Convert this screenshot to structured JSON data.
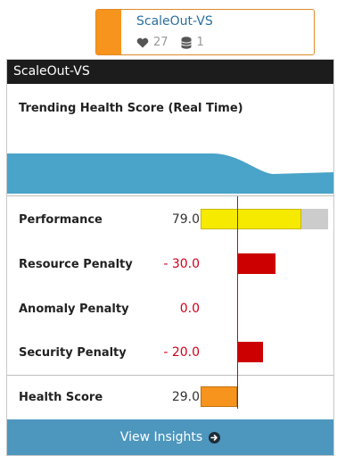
{
  "node": {
    "title": "ScaleOut-VS",
    "health_count": "27",
    "db_count": "1",
    "accent_color": "#f7941d"
  },
  "panel": {
    "header": "ScaleOut-VS",
    "trend_title": "Trending Health Score (Real Time)",
    "trend_color": "#4aa3c9"
  },
  "metrics": [
    {
      "label": "Performance",
      "value": "79.0",
      "bar_value": 79.0,
      "bar_max": 100,
      "color": "#f5ea00"
    },
    {
      "label": "Resource Penalty",
      "value": "- 30.0",
      "bar_value": 30.0,
      "color": "#cc0000"
    },
    {
      "label": "Anomaly Penalty",
      "value": "0.0",
      "bar_value": 0.0,
      "color": "#cc0000"
    },
    {
      "label": "Security Penalty",
      "value": "- 20.0",
      "bar_value": 20.0,
      "color": "#cc0000"
    }
  ],
  "health_score": {
    "label": "Health Score",
    "value": "29.0",
    "bar_value": 29.0,
    "color": "#f7941d"
  },
  "footer": {
    "button_label": "View Insights"
  }
}
